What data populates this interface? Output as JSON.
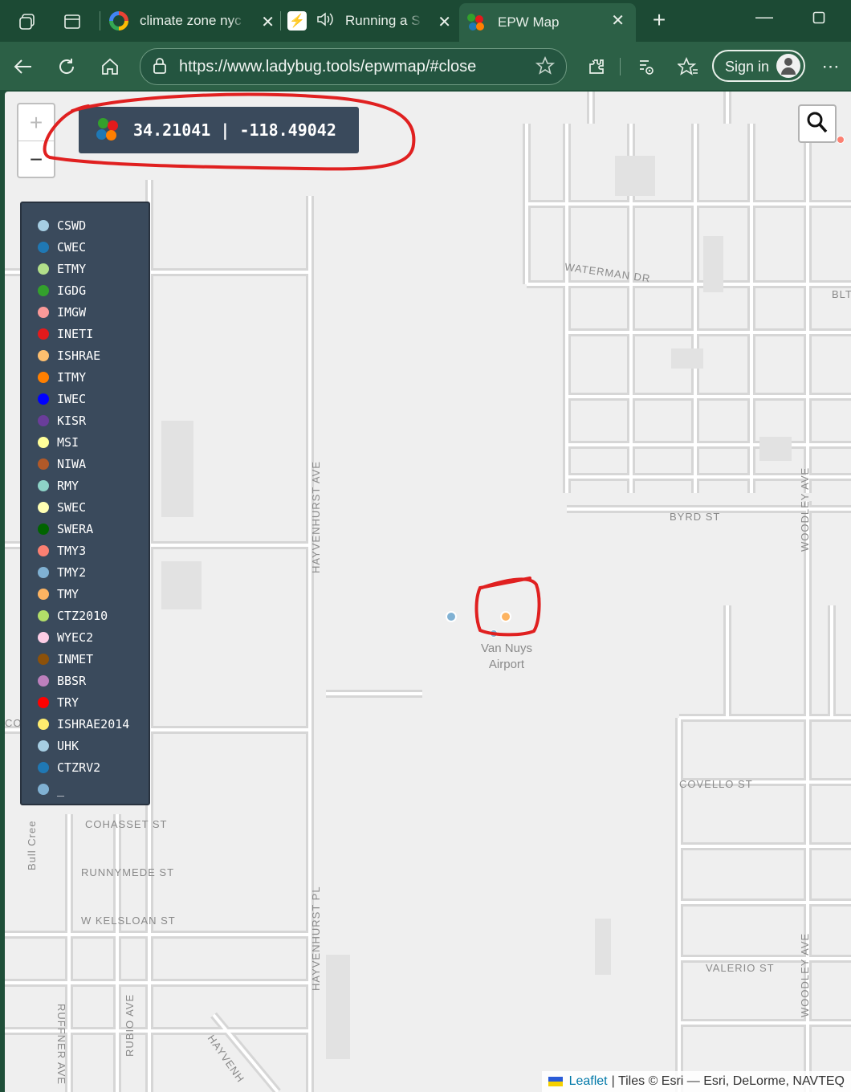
{
  "browser": {
    "tabs": [
      {
        "title": "climate zone nyc",
        "active": false
      },
      {
        "title": "Running a S",
        "active": false
      },
      {
        "title": "EPW Map",
        "active": true
      }
    ],
    "url": "https://www.ladybug.tools/epwmap/#close",
    "sign_in_label": "Sign in"
  },
  "map": {
    "coordinates": "34.21041 | -118.49042",
    "zoom_in_label": "+",
    "zoom_out_label": "−",
    "streets": {
      "waterman": "WATERMAN DR",
      "blt": "BLT",
      "byrd": "BYRD ST",
      "hayvenhurst_ave": "HAYVENHURST AVE",
      "woodley_ave_top": "WOODLEY AVE",
      "woodley_ave_bottom": "WOODLEY AVE",
      "covello": "COVELLO ST",
      "cohasset": "COHASSET ST",
      "runnymede": "RUNNYMEDE ST",
      "kelsloan": "W KELSLOAN ST",
      "hayvenhurst_pl": "HAYVENHURST PL",
      "valerio": "VALERIO ST",
      "rubio": "RUBIO AVE",
      "ruffner": "RUFFNER AVE",
      "hayvenhurst_diag": "HAYVENH",
      "bull_creek": "Bull Cree",
      "coy": "COY"
    },
    "airport_label_line1": "Van Nuys",
    "airport_label_line2": "Airport",
    "attribution_link": "Leaflet",
    "attribution_text": "| Tiles © Esri — Esri, DeLorme, NAVTEQ"
  },
  "legend": [
    {
      "label": "CSWD",
      "color": "#a6cee3"
    },
    {
      "label": "CWEC",
      "color": "#1f78b4"
    },
    {
      "label": "ETMY",
      "color": "#b2df8a"
    },
    {
      "label": "IGDG",
      "color": "#33a02c"
    },
    {
      "label": "IMGW",
      "color": "#fb9a99"
    },
    {
      "label": "INETI",
      "color": "#e31a1c"
    },
    {
      "label": "ISHRAE",
      "color": "#fdbf6f"
    },
    {
      "label": "ITMY",
      "color": "#ff7f00"
    },
    {
      "label": "IWEC",
      "color": "#0000ff"
    },
    {
      "label": "KISR",
      "color": "#6a3d9a"
    },
    {
      "label": "MSI",
      "color": "#ffff99"
    },
    {
      "label": "NIWA",
      "color": "#b15928"
    },
    {
      "label": "RMY",
      "color": "#8dd3c7"
    },
    {
      "label": "SWEC",
      "color": "#ffffb3"
    },
    {
      "label": "SWERA",
      "color": "#006400"
    },
    {
      "label": "TMY3",
      "color": "#fb8072"
    },
    {
      "label": "TMY2",
      "color": "#80b1d3"
    },
    {
      "label": "TMY",
      "color": "#fdb462"
    },
    {
      "label": "CTZ2010",
      "color": "#b3de69"
    },
    {
      "label": "WYEC2",
      "color": "#fccde5"
    },
    {
      "label": "INMET",
      "color": "#8c510a"
    },
    {
      "label": "BBSR",
      "color": "#bc80bd"
    },
    {
      "label": "TRY",
      "color": "#ff0000"
    },
    {
      "label": "ISHRAE2014",
      "color": "#ffed6f"
    },
    {
      "label": "UHK",
      "color": "#a6cee3"
    },
    {
      "label": "CTZRV2",
      "color": "#1f78b4"
    },
    {
      "label": "_",
      "color": "#80b1d3"
    }
  ]
}
